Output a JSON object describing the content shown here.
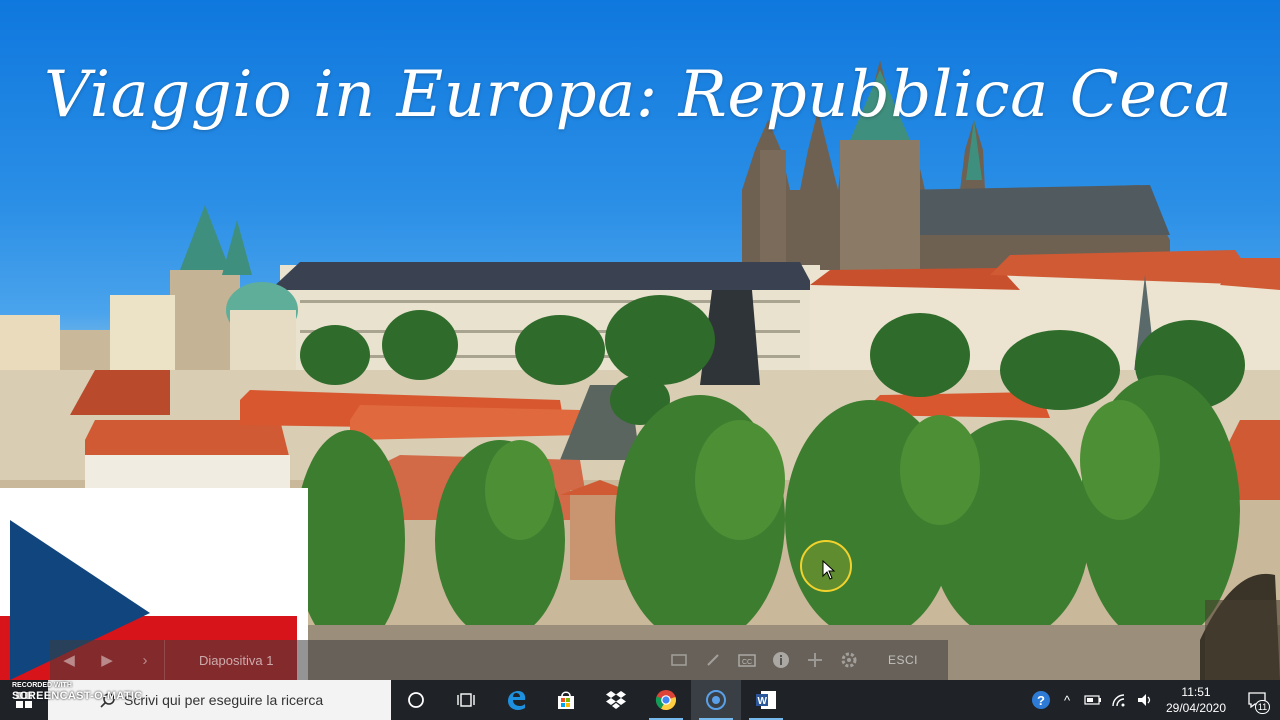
{
  "slide": {
    "title": "Viaggio in Europa: Repubblica Ceca"
  },
  "presenter_bar": {
    "slide_label": "Diapositiva 1",
    "exit_label": "ESCI"
  },
  "watermark": {
    "line1": "RECORDED WITH",
    "line2": "SCREENCAST-O-MATIC"
  },
  "taskbar": {
    "search_placeholder": "Scrivi qui per eseguire la ricerca",
    "apps": [
      {
        "name": "task-view",
        "icon": "task-view-icon"
      },
      {
        "name": "edge",
        "icon": "edge-icon"
      },
      {
        "name": "store",
        "icon": "store-icon"
      },
      {
        "name": "dropbox",
        "icon": "dropbox-icon"
      },
      {
        "name": "chrome",
        "icon": "chrome-icon"
      },
      {
        "name": "screencast",
        "icon": "record-icon"
      },
      {
        "name": "word",
        "icon": "word-icon"
      }
    ],
    "clock": {
      "time": "11:51",
      "date": "29/04/2020"
    },
    "notifications_count": "11"
  },
  "colors": {
    "sky": "#1e7fd8",
    "flag_blue": "#11457e",
    "flag_red": "#d7141a",
    "taskbar": "#1f2328",
    "cursor_highlight": "#f2d22c"
  }
}
